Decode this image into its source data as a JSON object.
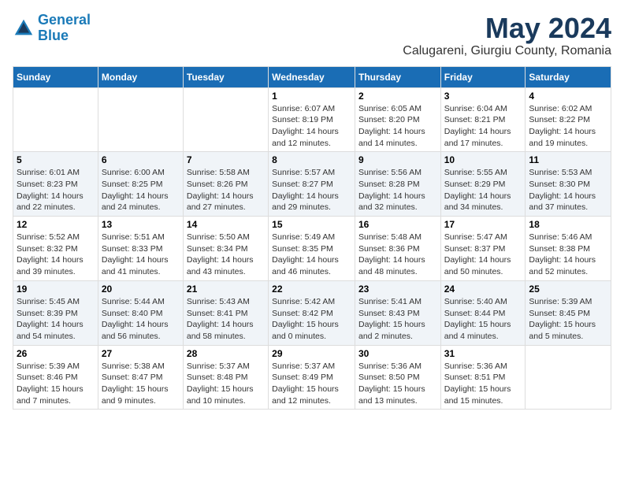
{
  "header": {
    "logo_line1": "General",
    "logo_line2": "Blue",
    "month_year": "May 2024",
    "location": "Calugareni, Giurgiu County, Romania"
  },
  "days_of_week": [
    "Sunday",
    "Monday",
    "Tuesday",
    "Wednesday",
    "Thursday",
    "Friday",
    "Saturday"
  ],
  "weeks": [
    [
      {
        "day": "",
        "info": ""
      },
      {
        "day": "",
        "info": ""
      },
      {
        "day": "",
        "info": ""
      },
      {
        "day": "1",
        "info": "Sunrise: 6:07 AM\nSunset: 8:19 PM\nDaylight: 14 hours\nand 12 minutes."
      },
      {
        "day": "2",
        "info": "Sunrise: 6:05 AM\nSunset: 8:20 PM\nDaylight: 14 hours\nand 14 minutes."
      },
      {
        "day": "3",
        "info": "Sunrise: 6:04 AM\nSunset: 8:21 PM\nDaylight: 14 hours\nand 17 minutes."
      },
      {
        "day": "4",
        "info": "Sunrise: 6:02 AM\nSunset: 8:22 PM\nDaylight: 14 hours\nand 19 minutes."
      }
    ],
    [
      {
        "day": "5",
        "info": "Sunrise: 6:01 AM\nSunset: 8:23 PM\nDaylight: 14 hours\nand 22 minutes."
      },
      {
        "day": "6",
        "info": "Sunrise: 6:00 AM\nSunset: 8:25 PM\nDaylight: 14 hours\nand 24 minutes."
      },
      {
        "day": "7",
        "info": "Sunrise: 5:58 AM\nSunset: 8:26 PM\nDaylight: 14 hours\nand 27 minutes."
      },
      {
        "day": "8",
        "info": "Sunrise: 5:57 AM\nSunset: 8:27 PM\nDaylight: 14 hours\nand 29 minutes."
      },
      {
        "day": "9",
        "info": "Sunrise: 5:56 AM\nSunset: 8:28 PM\nDaylight: 14 hours\nand 32 minutes."
      },
      {
        "day": "10",
        "info": "Sunrise: 5:55 AM\nSunset: 8:29 PM\nDaylight: 14 hours\nand 34 minutes."
      },
      {
        "day": "11",
        "info": "Sunrise: 5:53 AM\nSunset: 8:30 PM\nDaylight: 14 hours\nand 37 minutes."
      }
    ],
    [
      {
        "day": "12",
        "info": "Sunrise: 5:52 AM\nSunset: 8:32 PM\nDaylight: 14 hours\nand 39 minutes."
      },
      {
        "day": "13",
        "info": "Sunrise: 5:51 AM\nSunset: 8:33 PM\nDaylight: 14 hours\nand 41 minutes."
      },
      {
        "day": "14",
        "info": "Sunrise: 5:50 AM\nSunset: 8:34 PM\nDaylight: 14 hours\nand 43 minutes."
      },
      {
        "day": "15",
        "info": "Sunrise: 5:49 AM\nSunset: 8:35 PM\nDaylight: 14 hours\nand 46 minutes."
      },
      {
        "day": "16",
        "info": "Sunrise: 5:48 AM\nSunset: 8:36 PM\nDaylight: 14 hours\nand 48 minutes."
      },
      {
        "day": "17",
        "info": "Sunrise: 5:47 AM\nSunset: 8:37 PM\nDaylight: 14 hours\nand 50 minutes."
      },
      {
        "day": "18",
        "info": "Sunrise: 5:46 AM\nSunset: 8:38 PM\nDaylight: 14 hours\nand 52 minutes."
      }
    ],
    [
      {
        "day": "19",
        "info": "Sunrise: 5:45 AM\nSunset: 8:39 PM\nDaylight: 14 hours\nand 54 minutes."
      },
      {
        "day": "20",
        "info": "Sunrise: 5:44 AM\nSunset: 8:40 PM\nDaylight: 14 hours\nand 56 minutes."
      },
      {
        "day": "21",
        "info": "Sunrise: 5:43 AM\nSunset: 8:41 PM\nDaylight: 14 hours\nand 58 minutes."
      },
      {
        "day": "22",
        "info": "Sunrise: 5:42 AM\nSunset: 8:42 PM\nDaylight: 15 hours\nand 0 minutes."
      },
      {
        "day": "23",
        "info": "Sunrise: 5:41 AM\nSunset: 8:43 PM\nDaylight: 15 hours\nand 2 minutes."
      },
      {
        "day": "24",
        "info": "Sunrise: 5:40 AM\nSunset: 8:44 PM\nDaylight: 15 hours\nand 4 minutes."
      },
      {
        "day": "25",
        "info": "Sunrise: 5:39 AM\nSunset: 8:45 PM\nDaylight: 15 hours\nand 5 minutes."
      }
    ],
    [
      {
        "day": "26",
        "info": "Sunrise: 5:39 AM\nSunset: 8:46 PM\nDaylight: 15 hours\nand 7 minutes."
      },
      {
        "day": "27",
        "info": "Sunrise: 5:38 AM\nSunset: 8:47 PM\nDaylight: 15 hours\nand 9 minutes."
      },
      {
        "day": "28",
        "info": "Sunrise: 5:37 AM\nSunset: 8:48 PM\nDaylight: 15 hours\nand 10 minutes."
      },
      {
        "day": "29",
        "info": "Sunrise: 5:37 AM\nSunset: 8:49 PM\nDaylight: 15 hours\nand 12 minutes."
      },
      {
        "day": "30",
        "info": "Sunrise: 5:36 AM\nSunset: 8:50 PM\nDaylight: 15 hours\nand 13 minutes."
      },
      {
        "day": "31",
        "info": "Sunrise: 5:36 AM\nSunset: 8:51 PM\nDaylight: 15 hours\nand 15 minutes."
      },
      {
        "day": "",
        "info": ""
      }
    ]
  ]
}
